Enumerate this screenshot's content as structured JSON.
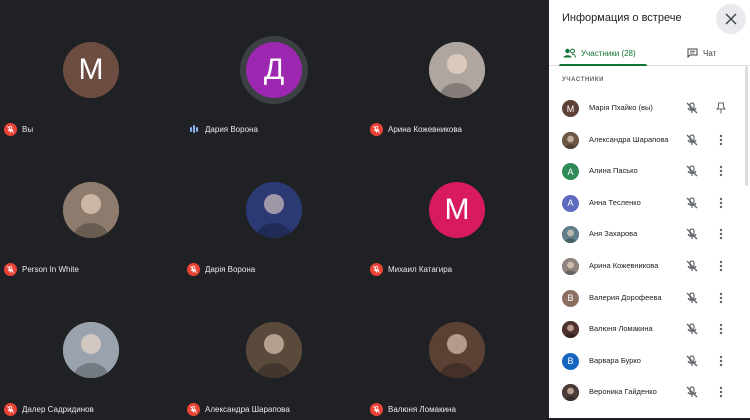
{
  "meeting": {
    "tiles": [
      {
        "name": "Вы",
        "initial": "М",
        "avatar_color": "#6d4c41",
        "type": "letter",
        "mic": "muted"
      },
      {
        "name": "Дария Ворона",
        "initial": "Д",
        "avatar_color": "#9c27b0",
        "type": "letter",
        "mic": "speaking"
      },
      {
        "name": "Арина Кожевникова",
        "initial": "",
        "avatar_color": "#b0a6a0",
        "type": "photo",
        "mic": "muted"
      },
      {
        "name": "Person In White",
        "initial": "",
        "avatar_color": "#8d7b6d",
        "type": "photo",
        "mic": "muted"
      },
      {
        "name": "Дарія Ворона",
        "initial": "",
        "avatar_color": "#2b3a73",
        "type": "photo",
        "mic": "muted"
      },
      {
        "name": "Михаил Катагира",
        "initial": "М",
        "avatar_color": "#d81b60",
        "type": "letter",
        "mic": "muted"
      },
      {
        "name": "Далер Садридинов",
        "initial": "",
        "avatar_color": "#9aa3ad",
        "type": "photo",
        "mic": "muted"
      },
      {
        "name": "Александра Шарапова",
        "initial": "",
        "avatar_color": "#5a4a3c",
        "type": "photo",
        "mic": "muted"
      },
      {
        "name": "Валюня Ломакина",
        "initial": "",
        "avatar_color": "#5b4034",
        "type": "photo",
        "mic": "muted"
      }
    ]
  },
  "panel": {
    "title": "Информация о встрече",
    "tab_participants": "Участники (28)",
    "tab_chat": "Чат",
    "section_label": "УЧАСТНИКИ",
    "participants": [
      {
        "name": "Марія Пхайко (вы)",
        "initial": "М",
        "color": "#5d4037",
        "type": "letter",
        "action": "pin"
      },
      {
        "name": "Александра Шарапова",
        "initial": "",
        "color": "#6b5846",
        "type": "photo",
        "action": "more"
      },
      {
        "name": "Алина Пасько",
        "initial": "А",
        "color": "#2e8b57",
        "type": "letter",
        "action": "more"
      },
      {
        "name": "Анна Тесленко",
        "initial": "А",
        "color": "#5c6bc0",
        "type": "letter",
        "action": "more"
      },
      {
        "name": "Аня Захарова",
        "initial": "",
        "color": "#607d8b",
        "type": "photo",
        "action": "more"
      },
      {
        "name": "Арина Кожевникова",
        "initial": "",
        "color": "#8d8480",
        "type": "photo",
        "action": "more"
      },
      {
        "name": "Валерия Дорофеева",
        "initial": "В",
        "color": "#8d6e63",
        "type": "letter",
        "action": "more"
      },
      {
        "name": "Валюня Ломакина",
        "initial": "",
        "color": "#4e342e",
        "type": "photo",
        "action": "more"
      },
      {
        "name": "Варвара Бурко",
        "initial": "В",
        "color": "#1565c0",
        "type": "letter",
        "action": "more"
      },
      {
        "name": "Вероника Гайденко",
        "initial": "",
        "color": "#4a3b36",
        "type": "photo",
        "action": "more"
      }
    ]
  }
}
